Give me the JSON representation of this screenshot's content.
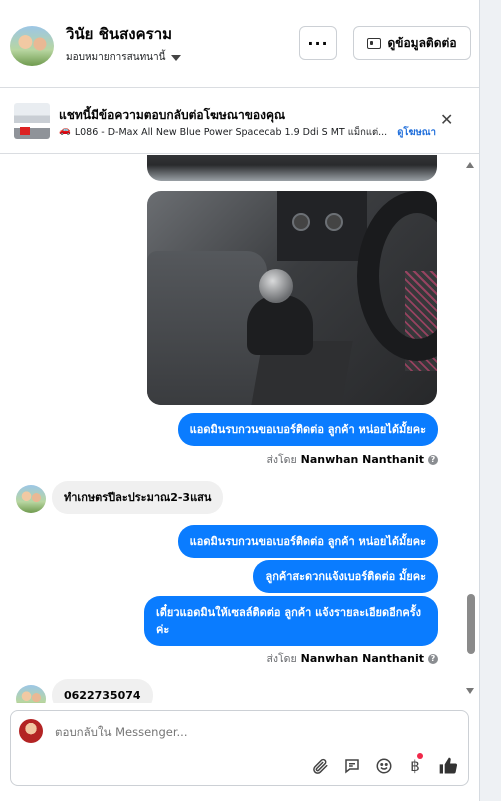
{
  "header": {
    "name": "วินัย ชินสงคราม",
    "assign_label": "มอบหมายการสนทนานี้",
    "more_label": "···",
    "contact_button": "ดูข้อมูลติดต่อ"
  },
  "ad": {
    "title": "แชทนี้มีข้อความตอบกลับต่อโฆษณาของคุณ",
    "description": "L086 - D-Max All New Blue Power Spacecab 1.9 Ddi S MT แม็กแต่...",
    "link": "ดูโฆษณา",
    "close": "✕"
  },
  "messages": [
    {
      "dir": "out",
      "text": "แอดมินรบกวนขอเบอร์ติดต่อ ลูกค้า หน่อยได้มั้ยคะ"
    },
    {
      "dir": "meta",
      "prefix": "ส่งโดย",
      "sender": "Nanwhan Nanthanit"
    },
    {
      "dir": "in",
      "text": "ทำเกษตรปีละประมาณ2-3แสน"
    },
    {
      "dir": "out",
      "text": "แอดมินรบกวนขอเบอร์ติดต่อ ลูกค้า หน่อยได้มั้ยคะ"
    },
    {
      "dir": "out",
      "text": "ลูกค้าสะดวกแจ้งเบอร์ติดต่อ มั้ยคะ"
    },
    {
      "dir": "out",
      "text": "เดี๋ยวแอดมินให้เซลล์ติดต่อ ลูกค้า แจ้งรายละเอียดอีกครั้ง ค่ะ"
    },
    {
      "dir": "meta",
      "prefix": "ส่งโดย",
      "sender": "Nanwhan Nanthanit"
    },
    {
      "dir": "in",
      "text": "0622735074"
    }
  ],
  "composer": {
    "placeholder": "ตอบกลับใน Messenger..."
  },
  "icons": [
    "paperclip-icon",
    "speech-bubble-icon",
    "emoji-icon",
    "baht-icon",
    "thumbs-up-icon"
  ],
  "colors": {
    "accent": "#0a7cff",
    "link": "#216fdb"
  }
}
